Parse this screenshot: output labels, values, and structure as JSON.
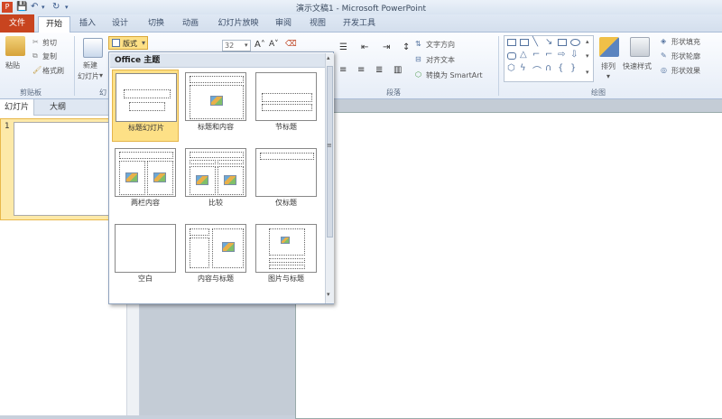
{
  "window": {
    "title": "演示文稿1 - Microsoft PowerPoint"
  },
  "tabs": [
    "文件",
    "开始",
    "插入",
    "设计",
    "切换",
    "动画",
    "幻灯片放映",
    "审阅",
    "视图",
    "开发工具"
  ],
  "ribbon": {
    "paste": "粘贴",
    "cut": "剪切",
    "copy": "复制",
    "format_painter": "格式刷",
    "clipboard_group": "剪贴板",
    "new_slide": "新建",
    "new_slide2": "幻灯片",
    "slides_group_short": "幻",
    "layout_button": "版式",
    "font_size": "32",
    "text_direction": "文字方向",
    "align_text": "对齐文本",
    "convert_smartart": "转换为 SmartArt",
    "paragraph_group": "段落",
    "arrange": "排列",
    "quick_styles": "快速样式",
    "shape_fill": "形状填充",
    "shape_outline": "形状轮廓",
    "shape_effects": "形状效果",
    "drawing_group": "绘图"
  },
  "left_panel": {
    "tab_slides": "幻灯片",
    "tab_outline": "大纲",
    "slide_number": "1"
  },
  "layout_gallery": {
    "header": "Office 主题",
    "items": [
      {
        "label": "标题幻灯片",
        "selected": true
      },
      {
        "label": "标题和内容",
        "selected": false
      },
      {
        "label": "节标题",
        "selected": false
      },
      {
        "label": "两栏内容",
        "selected": false
      },
      {
        "label": "比较",
        "selected": false
      },
      {
        "label": "仅标题",
        "selected": false
      },
      {
        "label": "空白",
        "selected": false
      },
      {
        "label": "内容与标题",
        "selected": false
      },
      {
        "label": "图片与标题",
        "selected": false
      }
    ]
  },
  "colors": {
    "file_tab": "#c8441f",
    "selected_highlight": "#fde086"
  }
}
